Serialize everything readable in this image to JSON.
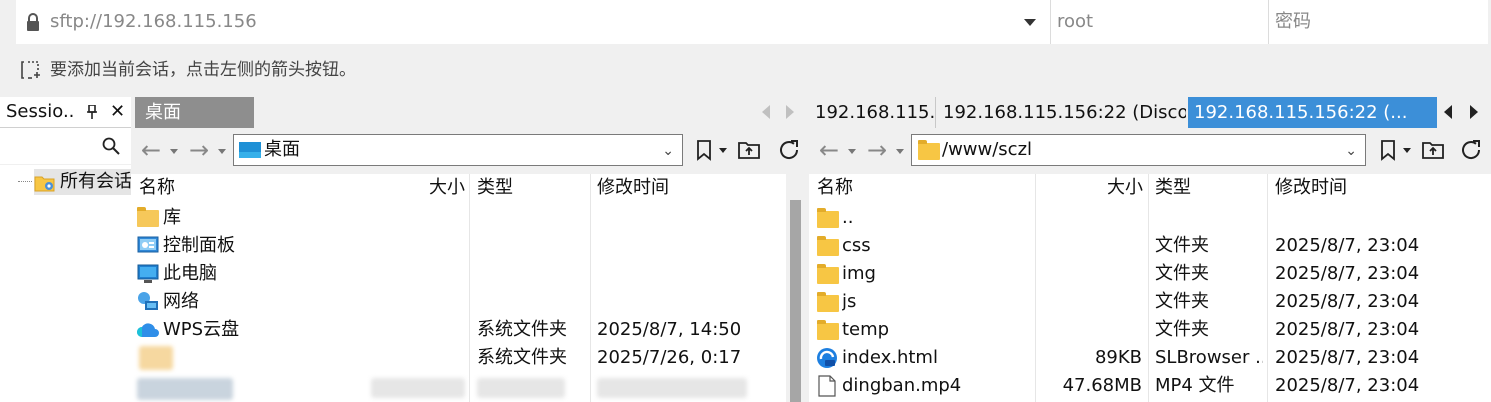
{
  "connection": {
    "address": "sftp://192.168.115.156",
    "username_placeholder": "root",
    "password_placeholder": "密码"
  },
  "hint": "要添加当前会话，点击左侧的箭头按钮。",
  "sessions_panel": {
    "title": "Sessio...",
    "close_glyph": "✕",
    "tree_item": "所有会话"
  },
  "left": {
    "tab_label": "桌面",
    "path": "桌面",
    "columns": {
      "name": "名称",
      "size": "大小",
      "type": "类型",
      "modified": "修改时间"
    },
    "rows": [
      {
        "name": "库",
        "size": "",
        "type": "",
        "modified": "",
        "icon": "library-folder-icon"
      },
      {
        "name": "控制面板",
        "size": "",
        "type": "",
        "modified": "",
        "icon": "control-panel-icon"
      },
      {
        "name": "此电脑",
        "size": "",
        "type": "",
        "modified": "",
        "icon": "computer-icon"
      },
      {
        "name": "网络",
        "size": "",
        "type": "",
        "modified": "",
        "icon": "network-icon"
      },
      {
        "name": "WPS云盘",
        "size": "",
        "type": "系统文件夹",
        "modified": "2025/8/7, 14:50",
        "icon": "cloud-icon"
      },
      {
        "name": "",
        "size": "",
        "type": "系统文件夹",
        "modified": "2025/7/26, 0:17",
        "icon": "blurred-icon"
      }
    ]
  },
  "right": {
    "tabs": [
      "192.168.115...",
      "192.168.115.156:22 (Disco...",
      "192.168.115.156:22 (..."
    ],
    "path": "/www/sczl",
    "columns": {
      "name": "名称",
      "size": "大小",
      "type": "类型",
      "modified": "修改时间"
    },
    "rows": [
      {
        "name": "..",
        "size": "",
        "type": "",
        "modified": "",
        "icon": "folder-icon"
      },
      {
        "name": "css",
        "size": "",
        "type": "文件夹",
        "modified": "2025/8/7, 23:04",
        "icon": "folder-icon"
      },
      {
        "name": "img",
        "size": "",
        "type": "文件夹",
        "modified": "2025/8/7, 23:04",
        "icon": "folder-icon"
      },
      {
        "name": "js",
        "size": "",
        "type": "文件夹",
        "modified": "2025/8/7, 23:04",
        "icon": "folder-icon"
      },
      {
        "name": "temp",
        "size": "",
        "type": "文件夹",
        "modified": "2025/8/7, 23:04",
        "icon": "folder-icon"
      },
      {
        "name": "index.html",
        "size": "89KB",
        "type": "SLBrowser ...",
        "modified": "2025/8/7, 23:04",
        "icon": "browser-file-icon"
      },
      {
        "name": "dingban.mp4",
        "size": "47.68MB",
        "type": "MP4 文件",
        "modified": "2025/8/7, 23:04",
        "icon": "blank-file-icon"
      }
    ]
  },
  "colors": {
    "active_tab": "#3c8fd8",
    "inactive_left_tab": "#8e8e8e",
    "folder": "#f7c644"
  }
}
